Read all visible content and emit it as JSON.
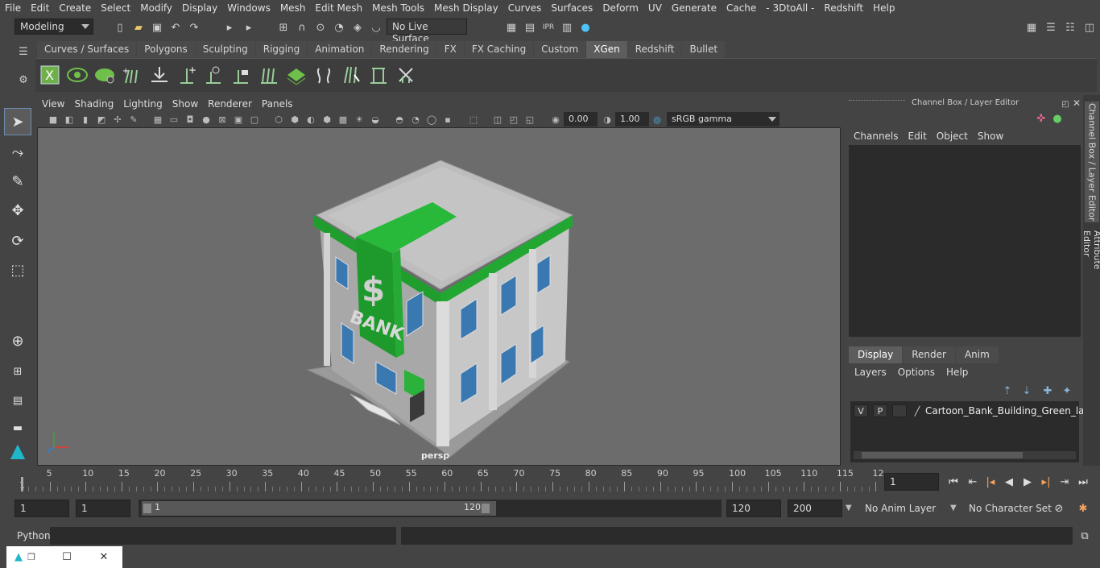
{
  "menubar": [
    "File",
    "Edit",
    "Create",
    "Select",
    "Modify",
    "Display",
    "Windows",
    "Mesh",
    "Edit Mesh",
    "Mesh Tools",
    "Mesh Display",
    "Curves",
    "Surfaces",
    "Deform",
    "UV",
    "Generate",
    "Cache",
    "- 3DtoAll -",
    "Redshift",
    "Help"
  ],
  "status": {
    "mode": "Modeling",
    "live_surface": "No Live Surface"
  },
  "shelf": {
    "tabs": [
      "Curves / Surfaces",
      "Polygons",
      "Sculpting",
      "Rigging",
      "Animation",
      "Rendering",
      "FX",
      "FX Caching",
      "Custom",
      "XGen",
      "Redshift",
      "Bullet"
    ],
    "active_tab": "XGen"
  },
  "viewport": {
    "menu": [
      "View",
      "Shading",
      "Lighting",
      "Show",
      "Renderer",
      "Panels"
    ],
    "exposure": "0.00",
    "gamma": "1.00",
    "color_space": "sRGB gamma",
    "camera": "persp",
    "model_sign_symbol": "$",
    "model_sign_text": "BANK"
  },
  "right_panel": {
    "title": "Channel Box / Layer Editor",
    "menu": [
      "Channels",
      "Edit",
      "Object",
      "Show"
    ],
    "tabs": [
      "Display",
      "Render",
      "Anim"
    ],
    "active_tab": "Display",
    "layer_menu": [
      "Layers",
      "Options",
      "Help"
    ],
    "layer": {
      "v": "V",
      "p": "P",
      "name": "Cartoon_Bank_Building_Green_layer"
    },
    "side_tabs": [
      "Channel Box / Layer Editor",
      "Attribute Editor"
    ]
  },
  "timeline": {
    "labels": [
      "5",
      "10",
      "15",
      "20",
      "25",
      "30",
      "35",
      "40",
      "45",
      "50",
      "55",
      "60",
      "65",
      "70",
      "75",
      "80",
      "85",
      "90",
      "95",
      "100",
      "105",
      "110",
      "115",
      "12"
    ],
    "start_label": "1",
    "current_frame": "1"
  },
  "range": {
    "start": "1",
    "playback_start": "1",
    "slider_start": "1",
    "slider_end": "120",
    "playback_end": "120",
    "end": "200",
    "anim_layer": "No Anim Layer",
    "character_set": "No Character Set"
  },
  "command": {
    "label": "Python"
  }
}
